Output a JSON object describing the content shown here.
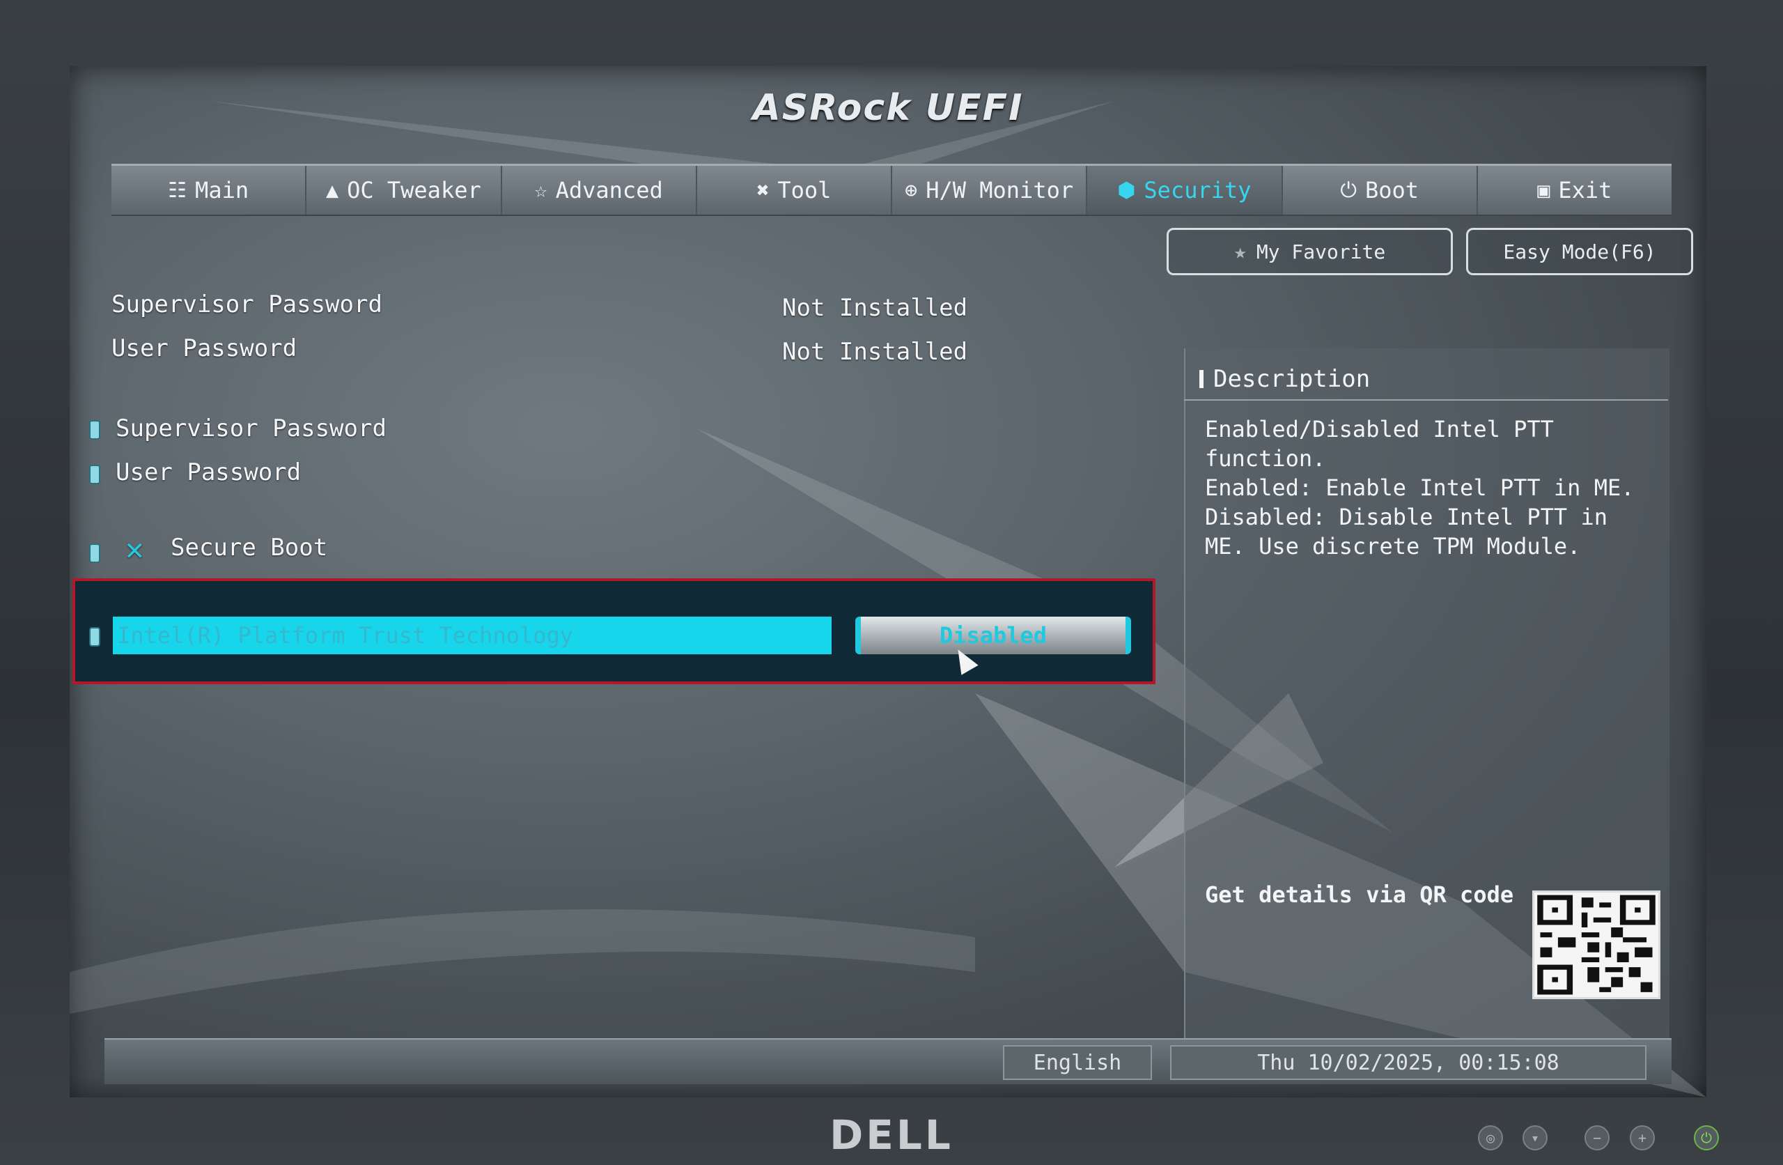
{
  "app": {
    "title": "ASRock UEFI"
  },
  "tabs": [
    {
      "label": "Main",
      "icon": "list-icon"
    },
    {
      "label": "OC Tweaker",
      "icon": "rocket-icon"
    },
    {
      "label": "Advanced",
      "icon": "star-icon"
    },
    {
      "label": "Tool",
      "icon": "tools-icon"
    },
    {
      "label": "H/W Monitor",
      "icon": "crosshair-icon"
    },
    {
      "label": "Security",
      "icon": "shield-icon",
      "active": true
    },
    {
      "label": "Boot",
      "icon": "power-icon"
    },
    {
      "label": "Exit",
      "icon": "exit-icon"
    }
  ],
  "top_buttons": {
    "favorite": "My Favorite",
    "easy_mode": "Easy Mode(F6)"
  },
  "status_rows": [
    {
      "label": "Supervisor Password",
      "value": "Not Installed"
    },
    {
      "label": "User Password",
      "value": "Not Installed"
    }
  ],
  "menu_items": [
    {
      "label": "Supervisor Password"
    },
    {
      "label": "User Password"
    },
    {
      "label": "Secure Boot"
    }
  ],
  "selected_item": {
    "label": "Intel(R) Platform Trust Technology",
    "value": "Disabled"
  },
  "description": {
    "title": "Description",
    "text": "Enabled/Disabled Intel PTT\nfunction.\nEnabled: Enable Intel PTT in ME.\nDisabled: Disable Intel PTT in\nME. Use discrete TPM Module.",
    "qr_label": "Get details via QR code"
  },
  "status_bar": {
    "language": "English",
    "datetime": "Thu 10/02/2025, 00:15:08"
  },
  "monitor": {
    "brand": "DELL"
  },
  "colors": {
    "accent": "#1cd3ea",
    "highlight_border": "#b3172a"
  }
}
